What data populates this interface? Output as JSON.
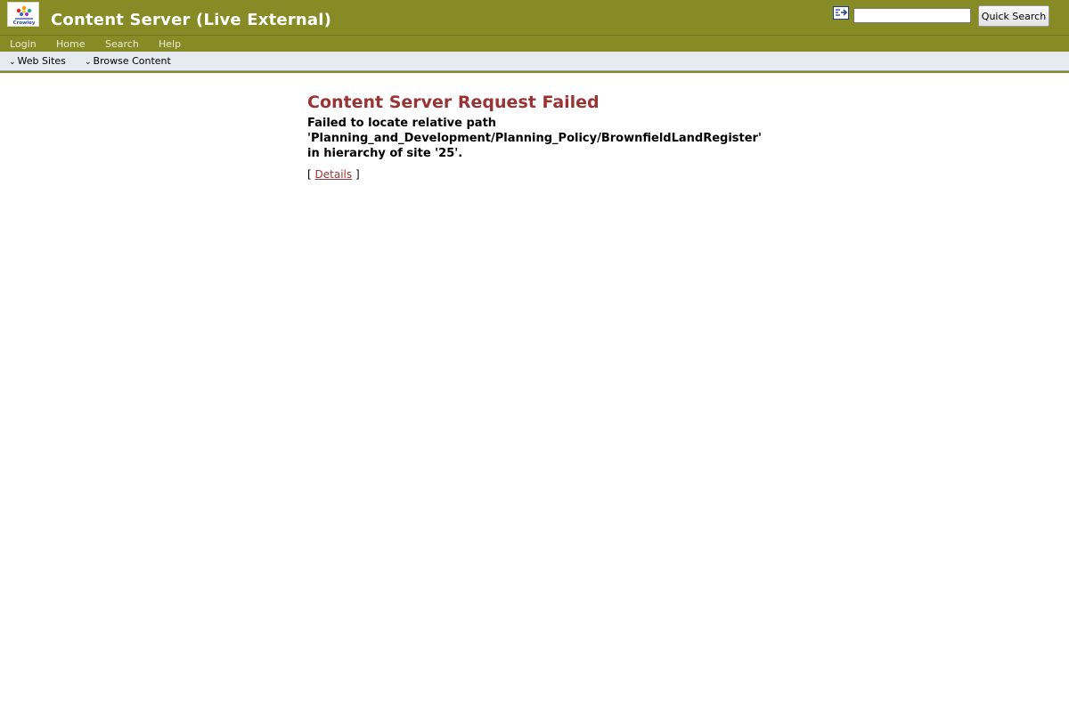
{
  "header": {
    "title": "Content Server (Live External)",
    "search_button": "Quick Search",
    "search_value": "",
    "logo_label": "Crowley"
  },
  "menu": {
    "items": [
      "Login",
      "Home",
      "Search",
      "Help"
    ]
  },
  "subnav": {
    "items": [
      "Web Sites",
      "Browse Content"
    ]
  },
  "error": {
    "title": "Content Server Request Failed",
    "line1": "Failed to locate relative path",
    "line2": "'Planning_and_Development/Planning_Policy/BrownfieldLandRegister'",
    "line3": "in hierarchy of site '25'.",
    "details_prefix": "[",
    "details_link": "Details",
    "details_suffix": "]"
  },
  "colors": {
    "header": "#868b26",
    "title_red": "#9a3434",
    "subbar": "#e6ebf1"
  }
}
